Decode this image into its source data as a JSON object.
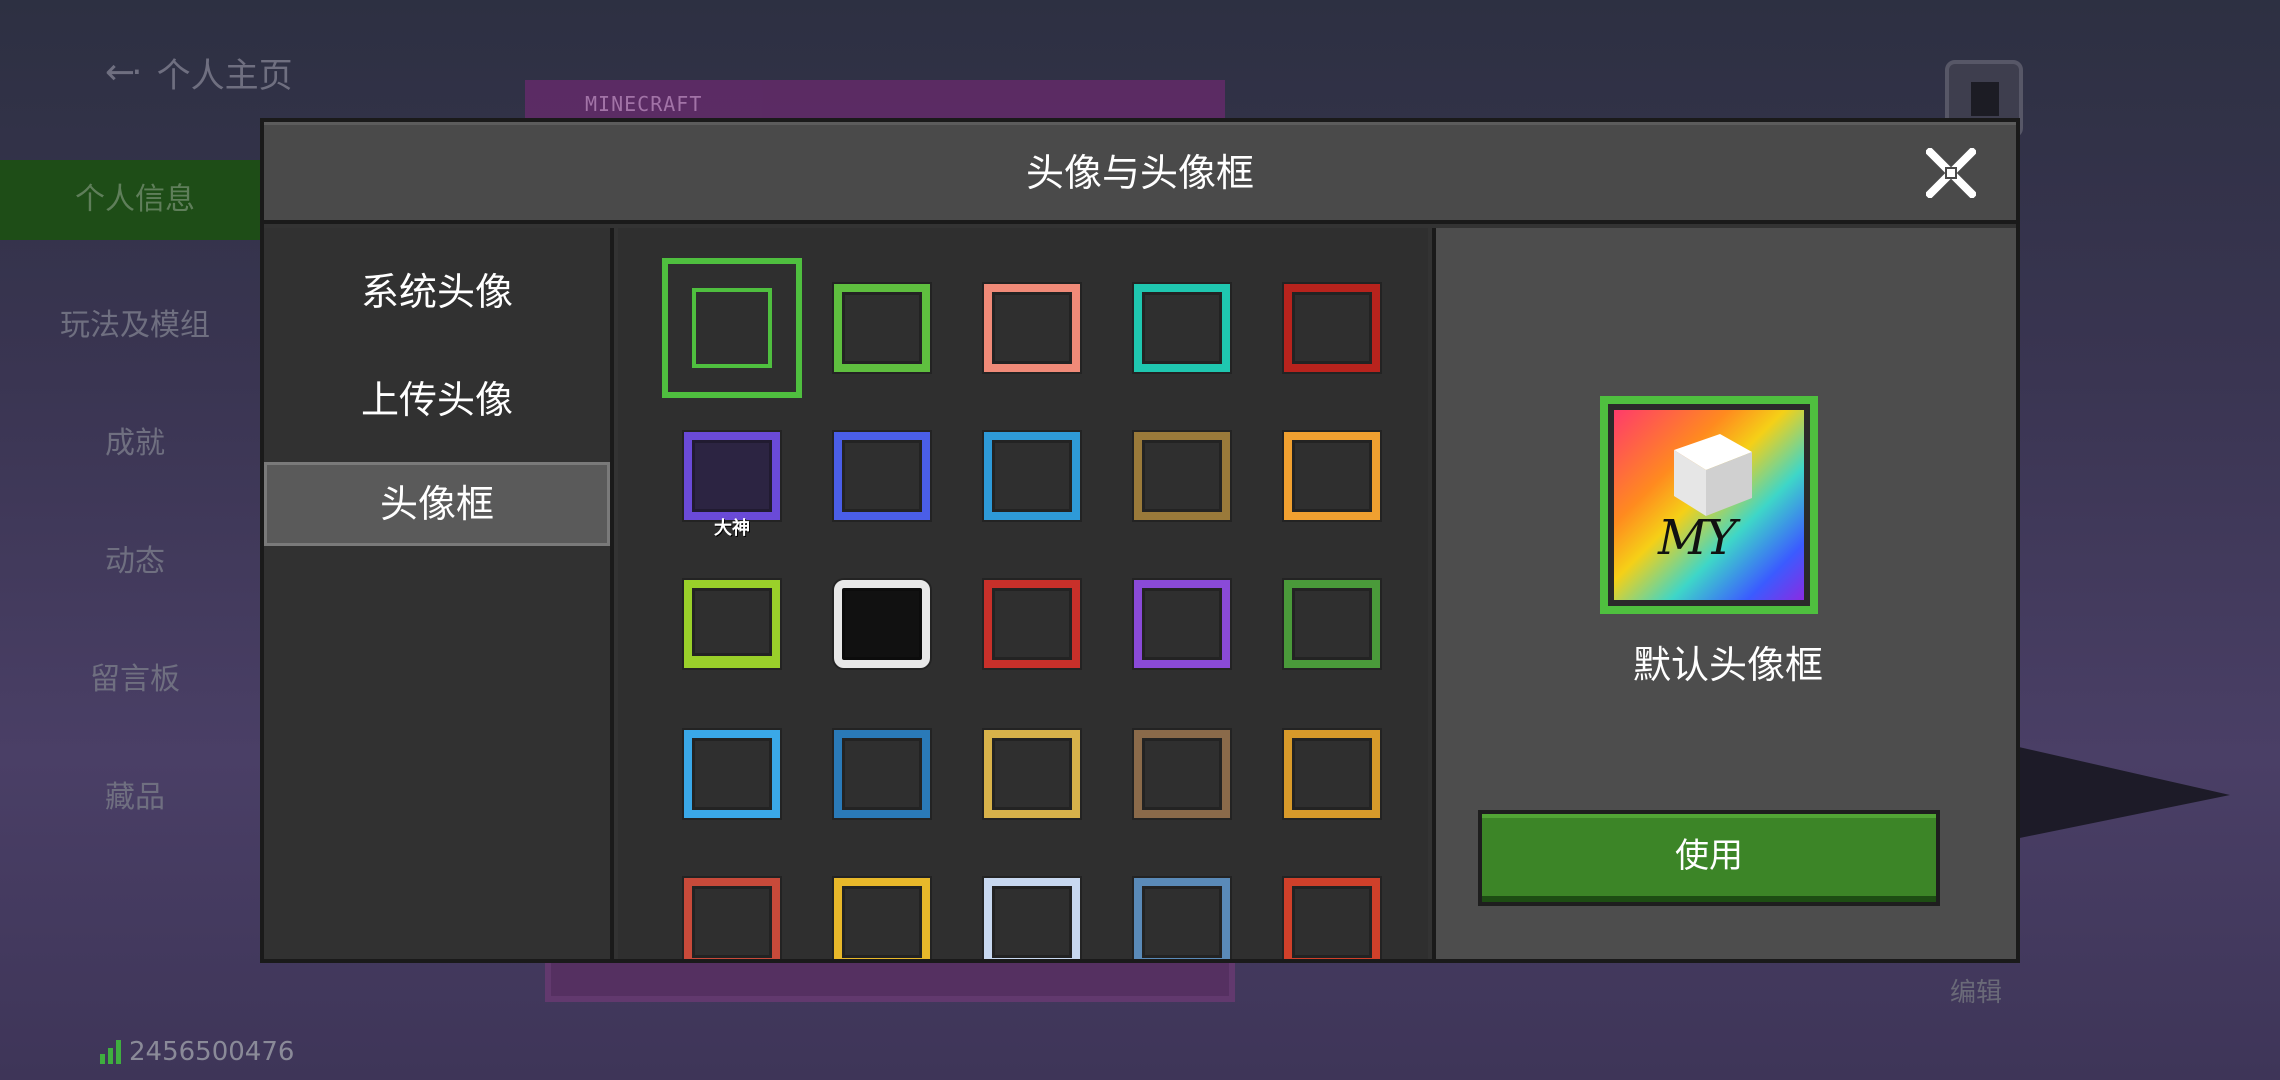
{
  "background": {
    "back_label": "个人主页",
    "nav_items": [
      {
        "label": "个人信息",
        "active": true
      },
      {
        "label": "玩法及模组"
      },
      {
        "label": "成就"
      },
      {
        "label": "动态"
      },
      {
        "label": "留言板"
      },
      {
        "label": "藏品"
      }
    ],
    "banner_text": "MINECRAFT",
    "edit_label": "编辑",
    "user_id": "2456500476"
  },
  "modal": {
    "title": "头像与头像框",
    "close_icon": "close-icon",
    "tabs": [
      {
        "label": "系统头像",
        "active": false
      },
      {
        "label": "上传头像",
        "active": false
      },
      {
        "label": "头像框",
        "active": true
      }
    ],
    "frames": [
      {
        "name": "default",
        "color": "#4fbf3f",
        "selected": true
      },
      {
        "name": "creeper",
        "color": "#5fbf3f"
      },
      {
        "name": "pig",
        "color": "#f08a78"
      },
      {
        "name": "diamond",
        "color": "#1fc7b0"
      },
      {
        "name": "redstone",
        "color": "#b8231d"
      },
      {
        "name": "dashen",
        "color": "#6a4ad8",
        "label": "大神"
      },
      {
        "name": "blue-camera",
        "color": "#4a5ee8"
      },
      {
        "name": "world-blue",
        "color": "#2e9ad8"
      },
      {
        "name": "world-wood",
        "color": "#9a7a3a"
      },
      {
        "name": "orange-gold",
        "color": "#f0a030"
      },
      {
        "name": "lime-arch",
        "color": "#9ad02a"
      },
      {
        "name": "phone",
        "color": "#e8e8e8"
      },
      {
        "name": "red-gift",
        "color": "#c8302a"
      },
      {
        "name": "purple-space",
        "color": "#8a4ad8"
      },
      {
        "name": "leaf",
        "color": "#4a9a3a"
      },
      {
        "name": "sky-blue",
        "color": "#3aa8e8"
      },
      {
        "name": "ocean",
        "color": "#2a7ab8"
      },
      {
        "name": "gold-wood",
        "color": "#d8b24a"
      },
      {
        "name": "brown",
        "color": "#8a6a4a"
      },
      {
        "name": "autumn",
        "color": "#d89a2a"
      },
      {
        "name": "fireworks",
        "color": "#c84a3a"
      },
      {
        "name": "golden-gate",
        "color": "#e8b82a"
      },
      {
        "name": "snow",
        "color": "#c8d8f0"
      },
      {
        "name": "bamboo",
        "color": "#5a8ab8"
      },
      {
        "name": "red-gate",
        "color": "#d0402a"
      }
    ],
    "preview": {
      "avatar_text": "MY",
      "name": "默认头像框",
      "use_label": "使用"
    }
  }
}
